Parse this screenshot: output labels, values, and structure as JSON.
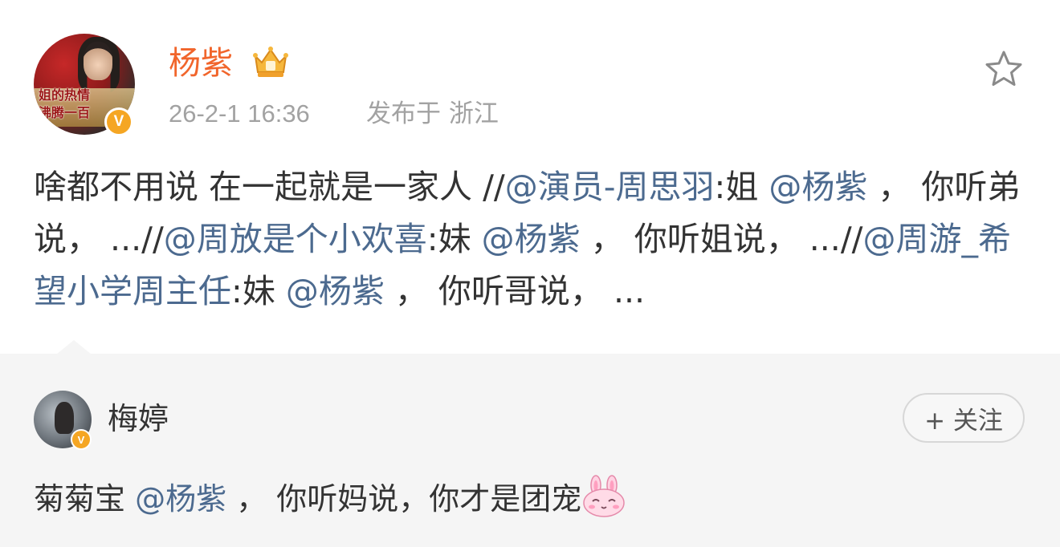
{
  "post": {
    "author": {
      "name": "杨紫",
      "avatar_banner_lines": [
        "姐的热情",
        "沸腾一百"
      ],
      "verified": true
    },
    "time": "26-2-1 16:36",
    "location": "发布于 浙江",
    "body_segments": [
      {
        "text": "啥都不用说 在一起就是一家人 //",
        "mention": false
      },
      {
        "text": "@演员-周思羽",
        "mention": true
      },
      {
        "text": ":姐 ",
        "mention": false
      },
      {
        "text": "@杨紫",
        "mention": true
      },
      {
        "text": " ， 你听弟说， ...//",
        "mention": false
      },
      {
        "text": "@周放是个小欢喜",
        "mention": true
      },
      {
        "text": ":妹 ",
        "mention": false
      },
      {
        "text": "@杨紫",
        "mention": true
      },
      {
        "text": " ， 你听姐说， ...//",
        "mention": false
      },
      {
        "text": "@周游_希望小学周主任",
        "mention": true
      },
      {
        "text": ":妹 ",
        "mention": false
      },
      {
        "text": "@杨紫",
        "mention": true
      },
      {
        "text": " ， 你听哥说， ...",
        "mention": false
      }
    ]
  },
  "comment": {
    "author": {
      "name": "梅婷",
      "verified": true
    },
    "follow_label": "+ 关注",
    "segments": [
      {
        "text": "菊菊宝 ",
        "mention": false
      },
      {
        "text": "@杨紫",
        "mention": true
      },
      {
        "text": " ， 你听妈说，你才是团宠",
        "mention": false
      }
    ]
  },
  "icons": {
    "star": "star-outline-icon",
    "crown": "crown-badge-icon",
    "verify": "verified-v-icon",
    "emoji": "bunny-emoji-icon"
  },
  "colors": {
    "author_name": "#f1652b",
    "mention": "#4c6a8f",
    "meta": "#a2a2a2",
    "verify_badge": "#f5a623",
    "comment_bg": "#f5f5f5"
  }
}
